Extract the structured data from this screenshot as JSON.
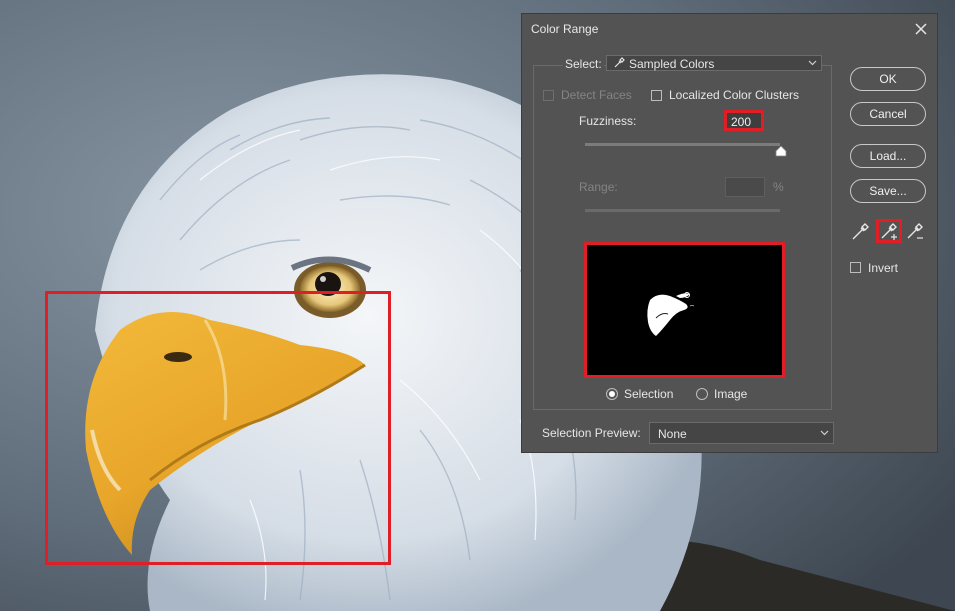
{
  "dialog": {
    "title": "Color Range",
    "select": {
      "label": "Select:",
      "value": "Sampled Colors",
      "icon": "eyedropper-icon"
    },
    "detect_faces": {
      "label": "Detect Faces",
      "checked": false,
      "enabled": false
    },
    "localized_clusters": {
      "label": "Localized Color Clusters",
      "checked": false
    },
    "fuzziness": {
      "label": "Fuzziness:",
      "value": "200",
      "slider_fraction": 1.0
    },
    "range": {
      "label": "Range:",
      "unit": "%",
      "value": "",
      "enabled": false
    },
    "preview_mode": {
      "options": [
        "Selection",
        "Image"
      ],
      "selected": "Selection"
    },
    "selection_preview": {
      "label": "Selection Preview:",
      "value": "None"
    },
    "buttons": {
      "ok": "OK",
      "cancel": "Cancel",
      "load": "Load...",
      "save": "Save..."
    },
    "eyedroppers": [
      "eyedropper-icon",
      "eyedropper-plus-icon",
      "eyedropper-minus-icon"
    ],
    "invert": {
      "label": "Invert",
      "checked": false
    }
  },
  "colors": {
    "accent_highlight": "#e01e26",
    "dialog_bg": "#535353",
    "beak": "#e8a62a"
  }
}
